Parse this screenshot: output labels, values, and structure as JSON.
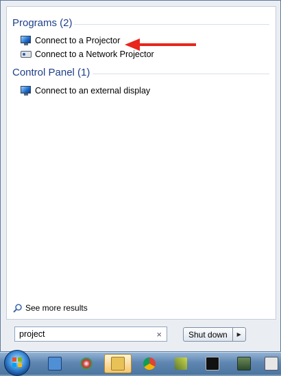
{
  "results": {
    "groups": [
      {
        "heading": "Programs (2)",
        "items": [
          {
            "label": "Connect to a Projector",
            "icon": "monitor-icon"
          },
          {
            "label": "Connect to a Network Projector",
            "icon": "projector-icon"
          }
        ]
      },
      {
        "heading": "Control Panel (1)",
        "items": [
          {
            "label": "Connect to an external display",
            "icon": "monitor-icon"
          }
        ]
      }
    ],
    "see_more": "See more results"
  },
  "search": {
    "value": "project"
  },
  "shutdown": {
    "label": "Shut down"
  },
  "colors": {
    "annotation_arrow": "#e8261b",
    "heading": "#1e3f8a"
  },
  "taskbar": {
    "items": [
      "start-orb",
      "computer-icon",
      "paint-icon",
      "file-explorer-icon",
      "chrome-icon",
      "tool-icon",
      "cmd-icon",
      "network-icon"
    ]
  }
}
